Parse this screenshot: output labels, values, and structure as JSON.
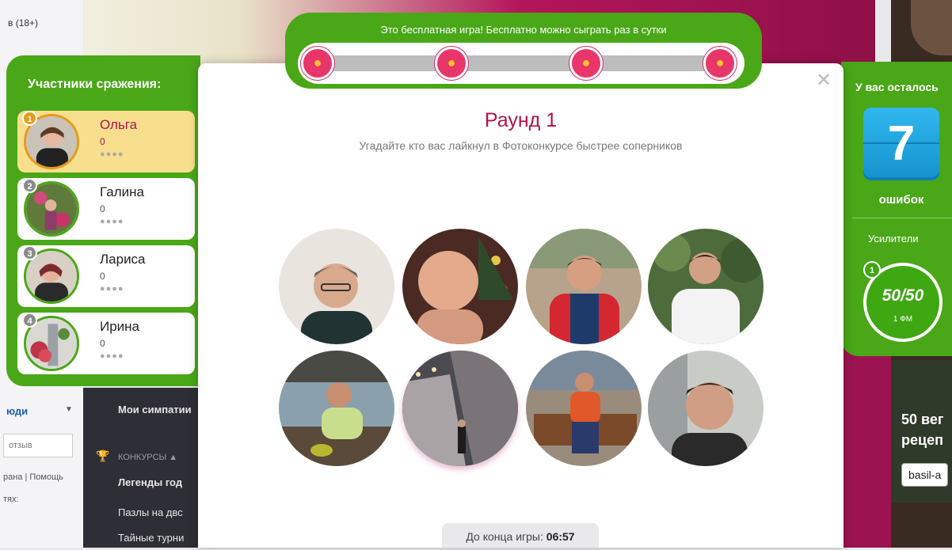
{
  "background": {
    "top_left_text": "в (18+)",
    "left_people": "юди",
    "left_review_placeholder": "отзыв",
    "left_links": "рана | Помощь",
    "left_links2": "тях:",
    "nav_items": [
      "Мои симпатии",
      "КОНКУРСЫ ▲",
      "Легенды год",
      "Пазлы на двс",
      "Тайные турни"
    ],
    "ad_text": "50 вег рецеп",
    "ad_link": "basil-a"
  },
  "top_bar": {
    "text": "Это бесплатная игра! Бесплатно можно сыграть раз в сутки",
    "nodes": 4
  },
  "participants": {
    "title": "Участники сражения:",
    "items": [
      {
        "rank": "1",
        "name": "Ольга",
        "score": "0",
        "icons": "👤👤👤👤",
        "active": true
      },
      {
        "rank": "2",
        "name": "Галина",
        "score": "0",
        "icons": "👤👤👤👤",
        "active": false
      },
      {
        "rank": "3",
        "name": "Лариса",
        "score": "0",
        "icons": "👤👤👤👤",
        "active": false
      },
      {
        "rank": "4",
        "name": "Ирина",
        "score": "0",
        "icons": "👤👤👤👤",
        "active": false
      }
    ]
  },
  "round": {
    "title": "Раунд 1",
    "subtitle": "Угадайте кто вас лайкнул в Фотоконкурсе быстрее соперников"
  },
  "errors": {
    "label": "У вас осталось",
    "count": "7",
    "word": "ошибок"
  },
  "boosters": {
    "label": "Усилители",
    "badge": "1",
    "main": "50/50",
    "cost": "1 ФМ"
  },
  "timer": {
    "label": "До конца игры:",
    "value": "06:57"
  },
  "colors": {
    "green": "#4aa718",
    "accent": "#b3134b",
    "blue": "#1592cf"
  }
}
